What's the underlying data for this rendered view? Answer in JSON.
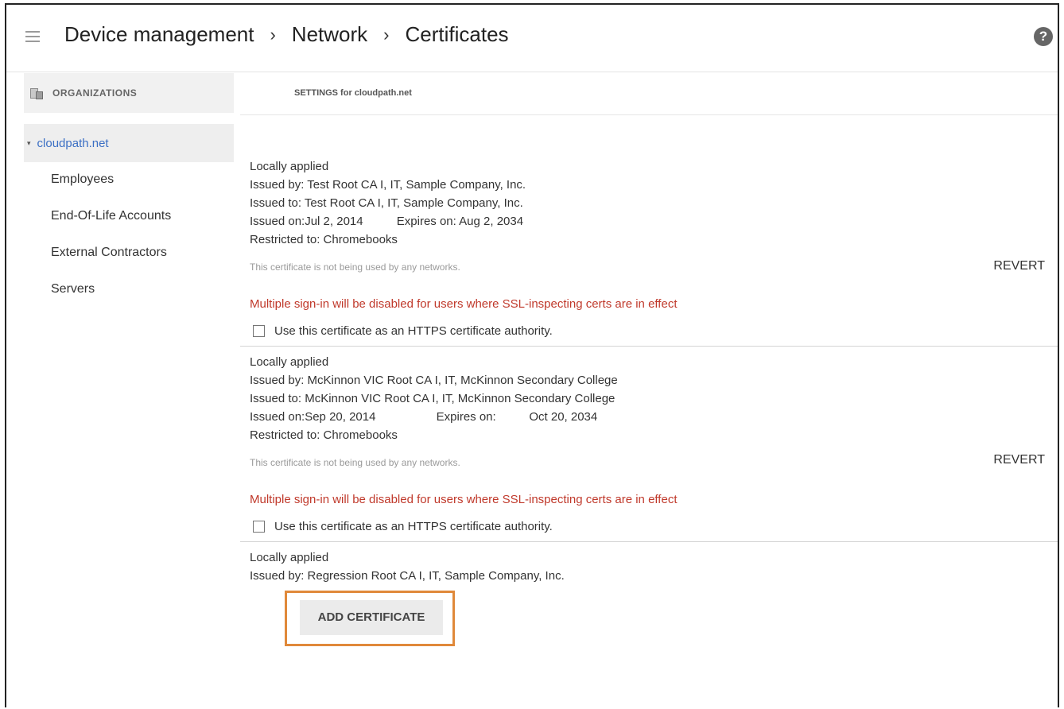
{
  "header": {
    "breadcrumb": [
      "Device management",
      "Network",
      "Certificates"
    ],
    "separator": "›",
    "help_icon": "?"
  },
  "sidebar": {
    "section_title": "ORGANIZATIONS",
    "root": {
      "label": "cloudpath.net",
      "caret": "▾"
    },
    "children": [
      "Employees",
      "End-Of-Life Accounts",
      "External Contractors",
      "Servers"
    ]
  },
  "settings": {
    "title": "SETTINGS for cloudpath.net"
  },
  "certificates": [
    {
      "status": "Locally applied",
      "issued_by": "Issued by: Test Root CA I, IT, Sample Company, Inc.",
      "issued_to": "Issued to: Test Root CA I, IT, Sample Company, Inc.",
      "issued_on": "Issued on:Jul 2, 2014",
      "expires": "Expires on:  Aug 2, 2034",
      "restricted": "Restricted to: Chromebooks",
      "usage": "This certificate is not being used by any networks.",
      "revert_label": "REVERT",
      "warning": "Multiple sign-in will be disabled for users where SSL-inspecting certs are in effect",
      "https_label": "Use this certificate as an HTTPS certificate authority."
    },
    {
      "status": "Locally applied",
      "issued_by": "Issued by: McKinnon VIC Root CA I, IT, McKinnon Secondary College",
      "issued_to": "Issued to: McKinnon VIC Root CA I, IT, McKinnon Secondary College",
      "issued_on": "Issued on:Sep 20, 2014",
      "expires": "Expires on:          Oct 20, 2034",
      "restricted": "Restricted to: Chromebooks",
      "usage": "This certificate is not being used by any networks.",
      "revert_label": "REVERT",
      "warning": "Multiple sign-in will be disabled for users where SSL-inspecting certs are in effect",
      "https_label": "Use this certificate as an HTTPS certificate authority."
    },
    {
      "status": "Locally applied",
      "issued_by": "Issued by: Regression Root CA I, IT, Sample Company, Inc."
    }
  ],
  "add_certificate_label": "ADD CERTIFICATE",
  "colors": {
    "link": "#3b6fc4",
    "warning": "#c0392b",
    "highlight": "#e0893a"
  },
  "icons": {
    "menu": "hamburger-icon",
    "help": "help-icon",
    "organizations": "organization-icon"
  }
}
